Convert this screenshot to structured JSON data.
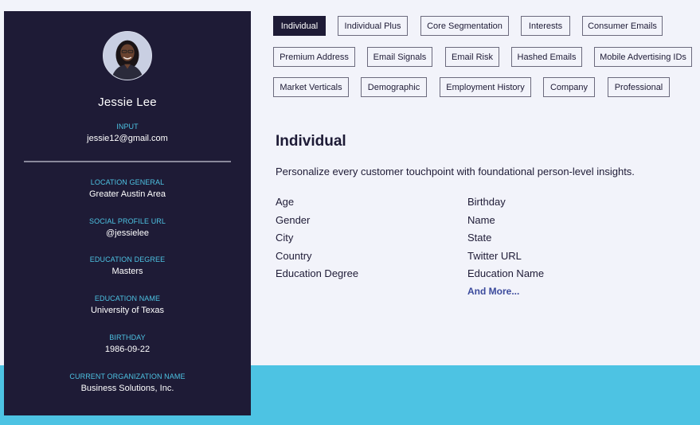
{
  "profile": {
    "name": "Jessie Lee",
    "fields": [
      {
        "label": "INPUT",
        "value": "jessie12@gmail.com"
      },
      {
        "label": "LOCATION GENERAL",
        "value": "Greater Austin Area"
      },
      {
        "label": "SOCIAL PROFILE URL",
        "value": "@jessielee"
      },
      {
        "label": "EDUCATION DEGREE",
        "value": "Masters"
      },
      {
        "label": "EDUCATION NAME",
        "value": "University of Texas"
      },
      {
        "label": "BIRTHDAY",
        "value": "1986-09-22"
      },
      {
        "label": "CURRENT ORGANIZATION NAME",
        "value": "Business Solutions, Inc."
      }
    ]
  },
  "tabs": [
    {
      "label": "Individual",
      "active": true
    },
    {
      "label": "Individual Plus"
    },
    {
      "label": "Core Segmentation"
    },
    {
      "label": "Interests"
    },
    {
      "label": "Consumer Emails"
    },
    {
      "label": "Premium Address"
    },
    {
      "label": "Email Signals"
    },
    {
      "label": "Email Risk"
    },
    {
      "label": "Hashed Emails"
    },
    {
      "label": "Mobile Advertising IDs"
    },
    {
      "label": "Market Verticals"
    },
    {
      "label": "Demographic"
    },
    {
      "label": "Employment History"
    },
    {
      "label": "Company"
    },
    {
      "label": "Professional"
    }
  ],
  "content": {
    "title": "Individual",
    "description": "Personalize every customer touchpoint with foundational person-level insights.",
    "attributes_left": [
      "Age",
      "Gender",
      "City",
      "Country",
      "Education Degree"
    ],
    "attributes_right": [
      "Birthday",
      "Name",
      "State",
      "Twitter URL",
      "Education Name"
    ],
    "more_link": "And More..."
  },
  "colors": {
    "card_bg": "#1e1b36",
    "accent": "#4dc3e3",
    "link": "#3b4a9c"
  }
}
